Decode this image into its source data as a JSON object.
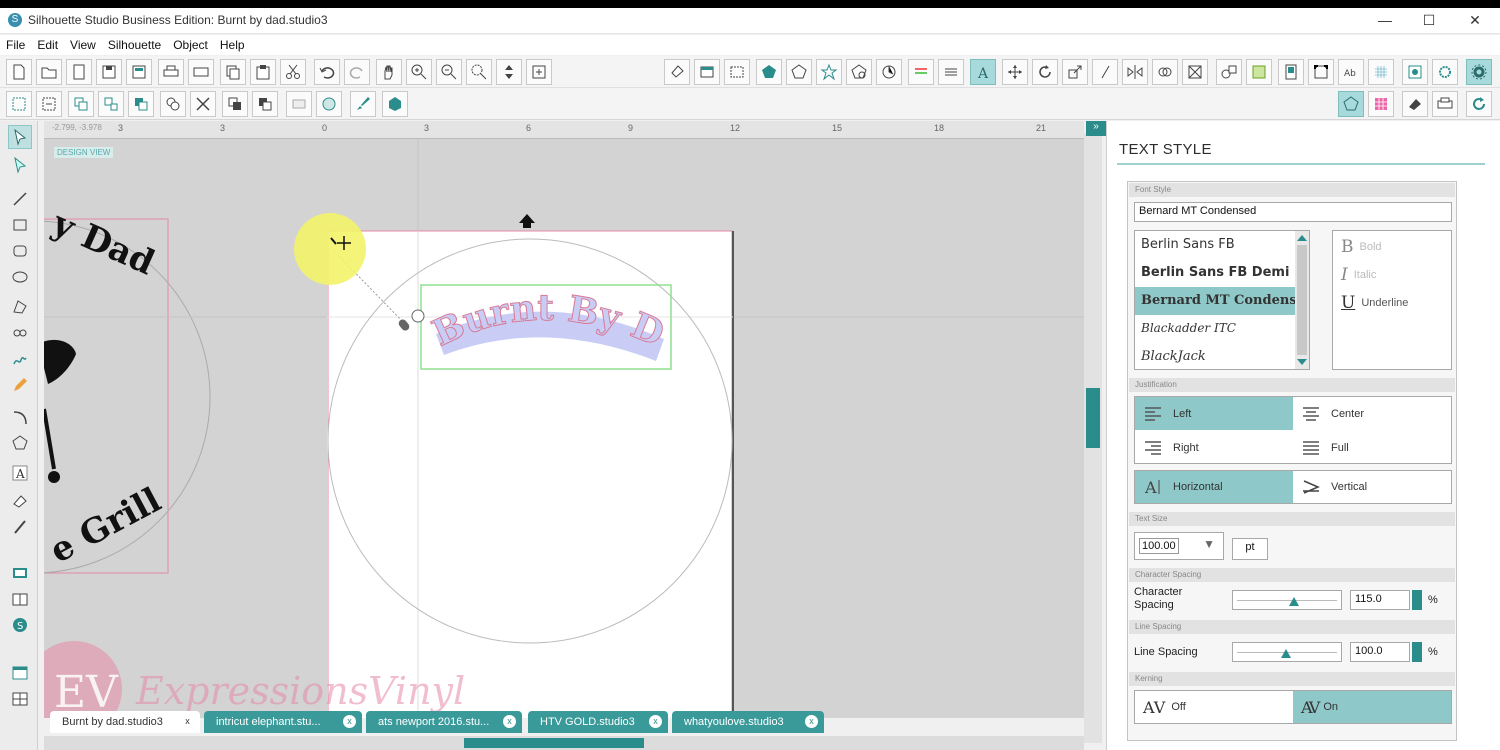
{
  "window": {
    "title": "Silhouette Studio Business Edition: Burnt by dad.studio3",
    "minimize": "—",
    "maximize": "☐",
    "close": "✕"
  },
  "menu": [
    "File",
    "Edit",
    "View",
    "Silhouette",
    "Object",
    "Help"
  ],
  "canvas": {
    "design_view_label": "DESIGN VIEW",
    "ruler_labels": [
      "3",
      "0",
      "3",
      "6",
      "9",
      "12",
      "15",
      "18",
      "21"
    ],
    "arc_text": "Burnt By Dad",
    "side_text_top": "y Dad",
    "side_text_bottom": "e Grill",
    "watermark": "ExpressionsVinyl",
    "watermark_logo": "EV"
  },
  "doc_tabs": [
    {
      "label": "Burnt by dad.studio3",
      "active": true
    },
    {
      "label": "intricut elephant.stu...",
      "active": false
    },
    {
      "label": "ats newport 2016.stu...",
      "active": false
    },
    {
      "label": "HTV GOLD.studio3",
      "active": false
    },
    {
      "label": "whatyoulove.studio3",
      "active": false
    }
  ],
  "panel": {
    "title": "TEXT STYLE",
    "font_style_header": "Font Style",
    "font_value": "Bernard MT Condensed",
    "fonts": [
      {
        "name": "Berlin Sans FB",
        "selected": false
      },
      {
        "name": "Berlin Sans FB Demi",
        "selected": false
      },
      {
        "name": "Bernard MT Condensed",
        "selected": true
      },
      {
        "name": "Blackadder ITC",
        "selected": false
      },
      {
        "name": "BlackJack",
        "selected": false
      }
    ],
    "styles": {
      "bold": "Bold",
      "italic": "Italic",
      "underline": "Underline"
    },
    "justification_header": "Justification",
    "justification": {
      "left": "Left",
      "center": "Center",
      "right": "Right",
      "full": "Full",
      "horizontal": "Horizontal",
      "vertical": "Vertical"
    },
    "text_size_header": "Text Size",
    "text_size": "100.00",
    "text_size_unit": "pt",
    "char_spacing_header": "Character Spacing",
    "char_spacing_label": "Character Spacing",
    "char_spacing_value": "115.0",
    "char_spacing_unit": "%",
    "line_spacing_header": "Line Spacing",
    "line_spacing_label": "Line Spacing",
    "line_spacing_value": "100.0",
    "line_spacing_unit": "%",
    "kerning_header": "Kerning",
    "kerning_off": "Off",
    "kerning_on": "On",
    "kerning_glyph": "AV"
  },
  "colors": {
    "accent": "#2b8c8c",
    "selected": "#8fc8c8",
    "text_fill": "#c9cdf6",
    "text_stroke": "#d87a96",
    "cut_line": "#e58aa6"
  }
}
